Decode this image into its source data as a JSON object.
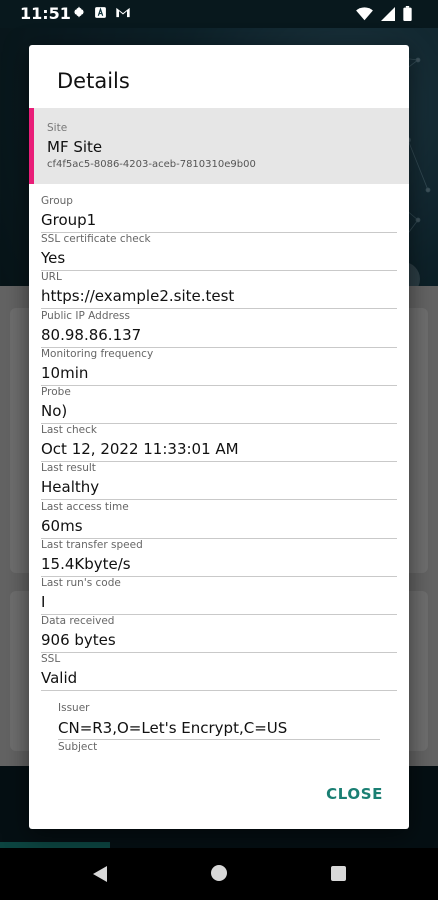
{
  "status_bar": {
    "time": "11:51",
    "left_icons": [
      "gear-icon",
      "notification-a-icon",
      "gmail-icon"
    ],
    "right_icons": [
      "wifi-icon",
      "signal-icon",
      "battery-icon"
    ]
  },
  "dialog": {
    "title": "Details",
    "site": {
      "label": "Site",
      "name": "MF Site",
      "id": "cf4f5ac5-8086-4203-aceb-7810310e9b00",
      "accent_color": "#e91e78"
    },
    "fields": [
      {
        "label": "Group",
        "value": "Group1"
      },
      {
        "label": "SSL certificate check",
        "value": "Yes"
      },
      {
        "label": "URL",
        "value": "https://example2.site.test"
      },
      {
        "label": "Public IP Address",
        "value": "80.98.86.137"
      },
      {
        "label": "Monitoring frequency",
        "value": "10min"
      },
      {
        "label": "Probe",
        "value": "No)"
      },
      {
        "label": "Last check",
        "value": "Oct 12, 2022 11:33:01 AM"
      },
      {
        "label": "Last result",
        "value": "Healthy"
      },
      {
        "label": "Last access time",
        "value": "60ms"
      },
      {
        "label": "Last transfer speed",
        "value": "15.4Kbyte/s"
      },
      {
        "label": "Last run's code",
        "value": "I"
      },
      {
        "label": "Data received",
        "value": "906 bytes"
      },
      {
        "label": "SSL",
        "value": "Valid"
      }
    ],
    "ssl_details": [
      {
        "label": "Issuer",
        "value": "CN=R3,O=Let's Encrypt,C=US"
      }
    ],
    "subject_label": "Subject",
    "close_label": "CLOSE",
    "close_color": "#1a7f73"
  },
  "nav_bar": {
    "icons": [
      "back-icon",
      "home-icon",
      "recents-icon"
    ]
  }
}
